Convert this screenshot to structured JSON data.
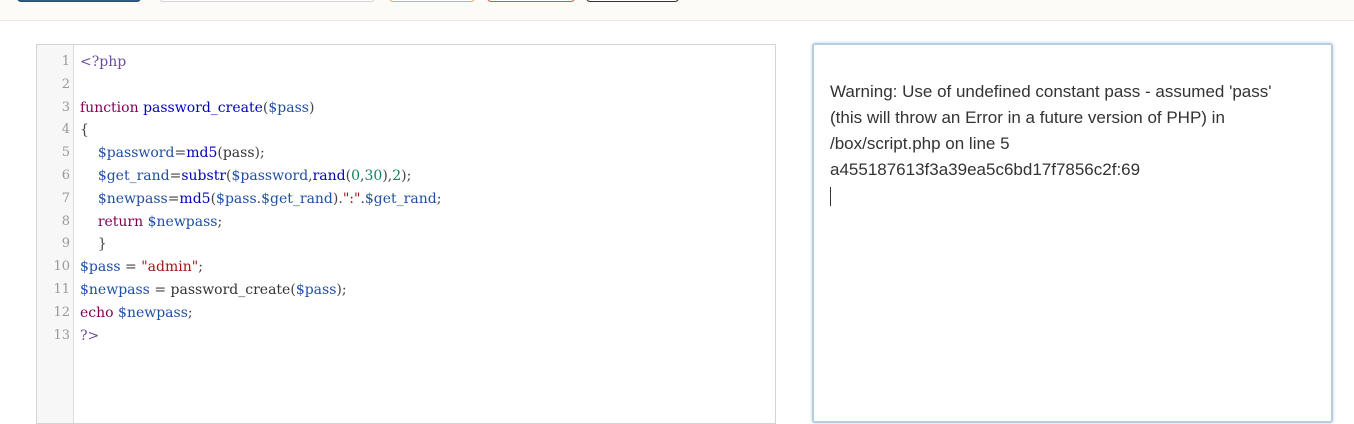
{
  "editor": {
    "lines": [
      {
        "n": "1",
        "tokens": [
          {
            "t": "<?php",
            "c": "tag"
          }
        ]
      },
      {
        "n": "2",
        "tokens": []
      },
      {
        "n": "3",
        "tokens": [
          {
            "t": "function",
            "c": "kw"
          },
          {
            "t": " ",
            "c": "pl"
          },
          {
            "t": "password_create",
            "c": "fn"
          },
          {
            "t": "(",
            "c": "pun"
          },
          {
            "t": "$pass",
            "c": "var"
          },
          {
            "t": ")",
            "c": "pun"
          }
        ]
      },
      {
        "n": "4",
        "tokens": [
          {
            "t": "{",
            "c": "pun"
          }
        ]
      },
      {
        "n": "5",
        "tokens": [
          {
            "t": "    ",
            "c": "pl"
          },
          {
            "t": "$password",
            "c": "var"
          },
          {
            "t": "=",
            "c": "pun"
          },
          {
            "t": "md5",
            "c": "fn"
          },
          {
            "t": "(",
            "c": "pun"
          },
          {
            "t": "pass",
            "c": "pl"
          },
          {
            "t": ");",
            "c": "pun"
          }
        ]
      },
      {
        "n": "6",
        "tokens": [
          {
            "t": "    ",
            "c": "pl"
          },
          {
            "t": "$get_rand",
            "c": "var"
          },
          {
            "t": "=",
            "c": "pun"
          },
          {
            "t": "substr",
            "c": "fn"
          },
          {
            "t": "(",
            "c": "pun"
          },
          {
            "t": "$password",
            "c": "var"
          },
          {
            "t": ",",
            "c": "pun"
          },
          {
            "t": "rand",
            "c": "fn"
          },
          {
            "t": "(",
            "c": "pun"
          },
          {
            "t": "0",
            "c": "num"
          },
          {
            "t": ",",
            "c": "pun"
          },
          {
            "t": "30",
            "c": "num"
          },
          {
            "t": "),",
            "c": "pun"
          },
          {
            "t": "2",
            "c": "num"
          },
          {
            "t": ");",
            "c": "pun"
          }
        ]
      },
      {
        "n": "7",
        "tokens": [
          {
            "t": "    ",
            "c": "pl"
          },
          {
            "t": "$newpass",
            "c": "var"
          },
          {
            "t": "=",
            "c": "pun"
          },
          {
            "t": "md5",
            "c": "fn"
          },
          {
            "t": "(",
            "c": "pun"
          },
          {
            "t": "$pass",
            "c": "var"
          },
          {
            "t": ".",
            "c": "pun"
          },
          {
            "t": "$get_rand",
            "c": "var"
          },
          {
            "t": ").",
            "c": "pun"
          },
          {
            "t": "\":\"",
            "c": "str"
          },
          {
            "t": ".",
            "c": "pun"
          },
          {
            "t": "$get_rand",
            "c": "var"
          },
          {
            "t": ";",
            "c": "pun"
          }
        ]
      },
      {
        "n": "8",
        "tokens": [
          {
            "t": "    ",
            "c": "pl"
          },
          {
            "t": "return",
            "c": "kw"
          },
          {
            "t": " ",
            "c": "pl"
          },
          {
            "t": "$newpass",
            "c": "var"
          },
          {
            "t": ";",
            "c": "pun"
          }
        ]
      },
      {
        "n": "9",
        "tokens": [
          {
            "t": "    ",
            "c": "pl"
          },
          {
            "t": "}",
            "c": "pun"
          }
        ]
      },
      {
        "n": "10",
        "tokens": [
          {
            "t": "$pass",
            "c": "var"
          },
          {
            "t": " = ",
            "c": "pun"
          },
          {
            "t": "\"admin\"",
            "c": "str"
          },
          {
            "t": ";",
            "c": "pun"
          }
        ]
      },
      {
        "n": "11",
        "tokens": [
          {
            "t": "$newpass",
            "c": "var"
          },
          {
            "t": " = ",
            "c": "pun"
          },
          {
            "t": "password_create",
            "c": "pl"
          },
          {
            "t": "(",
            "c": "pun"
          },
          {
            "t": "$pass",
            "c": "var"
          },
          {
            "t": ");",
            "c": "pun"
          }
        ]
      },
      {
        "n": "12",
        "tokens": [
          {
            "t": "echo",
            "c": "kw"
          },
          {
            "t": " ",
            "c": "pl"
          },
          {
            "t": "$newpass",
            "c": "var"
          },
          {
            "t": ";",
            "c": "pun"
          }
        ]
      },
      {
        "n": "13",
        "tokens": [
          {
            "t": "?>",
            "c": "tag"
          }
        ]
      }
    ]
  },
  "output": {
    "lines": [
      "Warning: Use of undefined constant pass - assumed 'pass'",
      "(this will throw an Error in a future version of PHP) in",
      "/box/script.php on line 5",
      "a455187613f3a39ea5c6bd17f7856c2f:69"
    ]
  },
  "colors": {
    "primary_button": "#2f5b85",
    "warning_button": "#f0ad4e",
    "danger_button": "#d9534f",
    "output_focus_border": "#b9cde0"
  }
}
